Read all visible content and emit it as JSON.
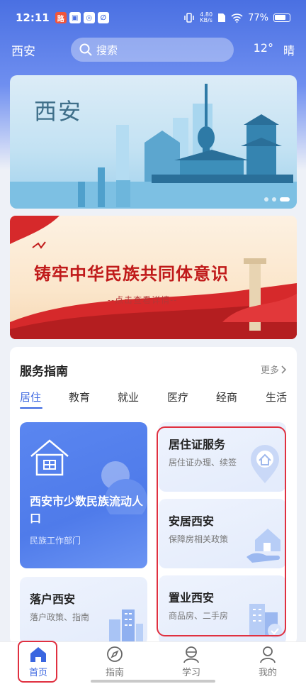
{
  "status_bar": {
    "time": "12:11",
    "apps": [
      "路",
      "▣",
      "◎",
      "∅"
    ],
    "net_speed_top": "4.80",
    "net_speed_bottom": "KB/s",
    "battery": "77%"
  },
  "header": {
    "city": "西安",
    "search_placeholder": "搜索",
    "temperature": "12°",
    "weather": "晴"
  },
  "banners": {
    "city_banner_title": "西安",
    "patriotic_title": "铸牢中华民族共同体意识",
    "patriotic_subtitle": "--点击查看详情--"
  },
  "service": {
    "title": "服务指南",
    "more_label": "更多",
    "tabs": [
      "居住",
      "教育",
      "就业",
      "医疗",
      "经商",
      "生活"
    ],
    "active_tab": "居住",
    "cards": [
      {
        "title": "西安市少数民族流动人口",
        "subtitle": "民族工作部门"
      },
      {
        "title": "落户西安",
        "subtitle": "落户政策、指南"
      },
      {
        "title": "居住证服务",
        "subtitle": "居住证办理、续签"
      },
      {
        "title": "安居西安",
        "subtitle": "保障房相关政策"
      },
      {
        "title": "置业西安",
        "subtitle": "商品房、二手房"
      }
    ]
  },
  "bottom_nav": [
    {
      "label": "首页",
      "icon": "home-icon",
      "active": true
    },
    {
      "label": "指南",
      "icon": "compass-icon",
      "active": false
    },
    {
      "label": "学习",
      "icon": "study-icon",
      "active": false
    },
    {
      "label": "我的",
      "icon": "user-icon",
      "active": false
    }
  ],
  "colors": {
    "primary": "#3a66e0",
    "highlight_red": "#e03040",
    "header_blue": "#4a70e2"
  }
}
